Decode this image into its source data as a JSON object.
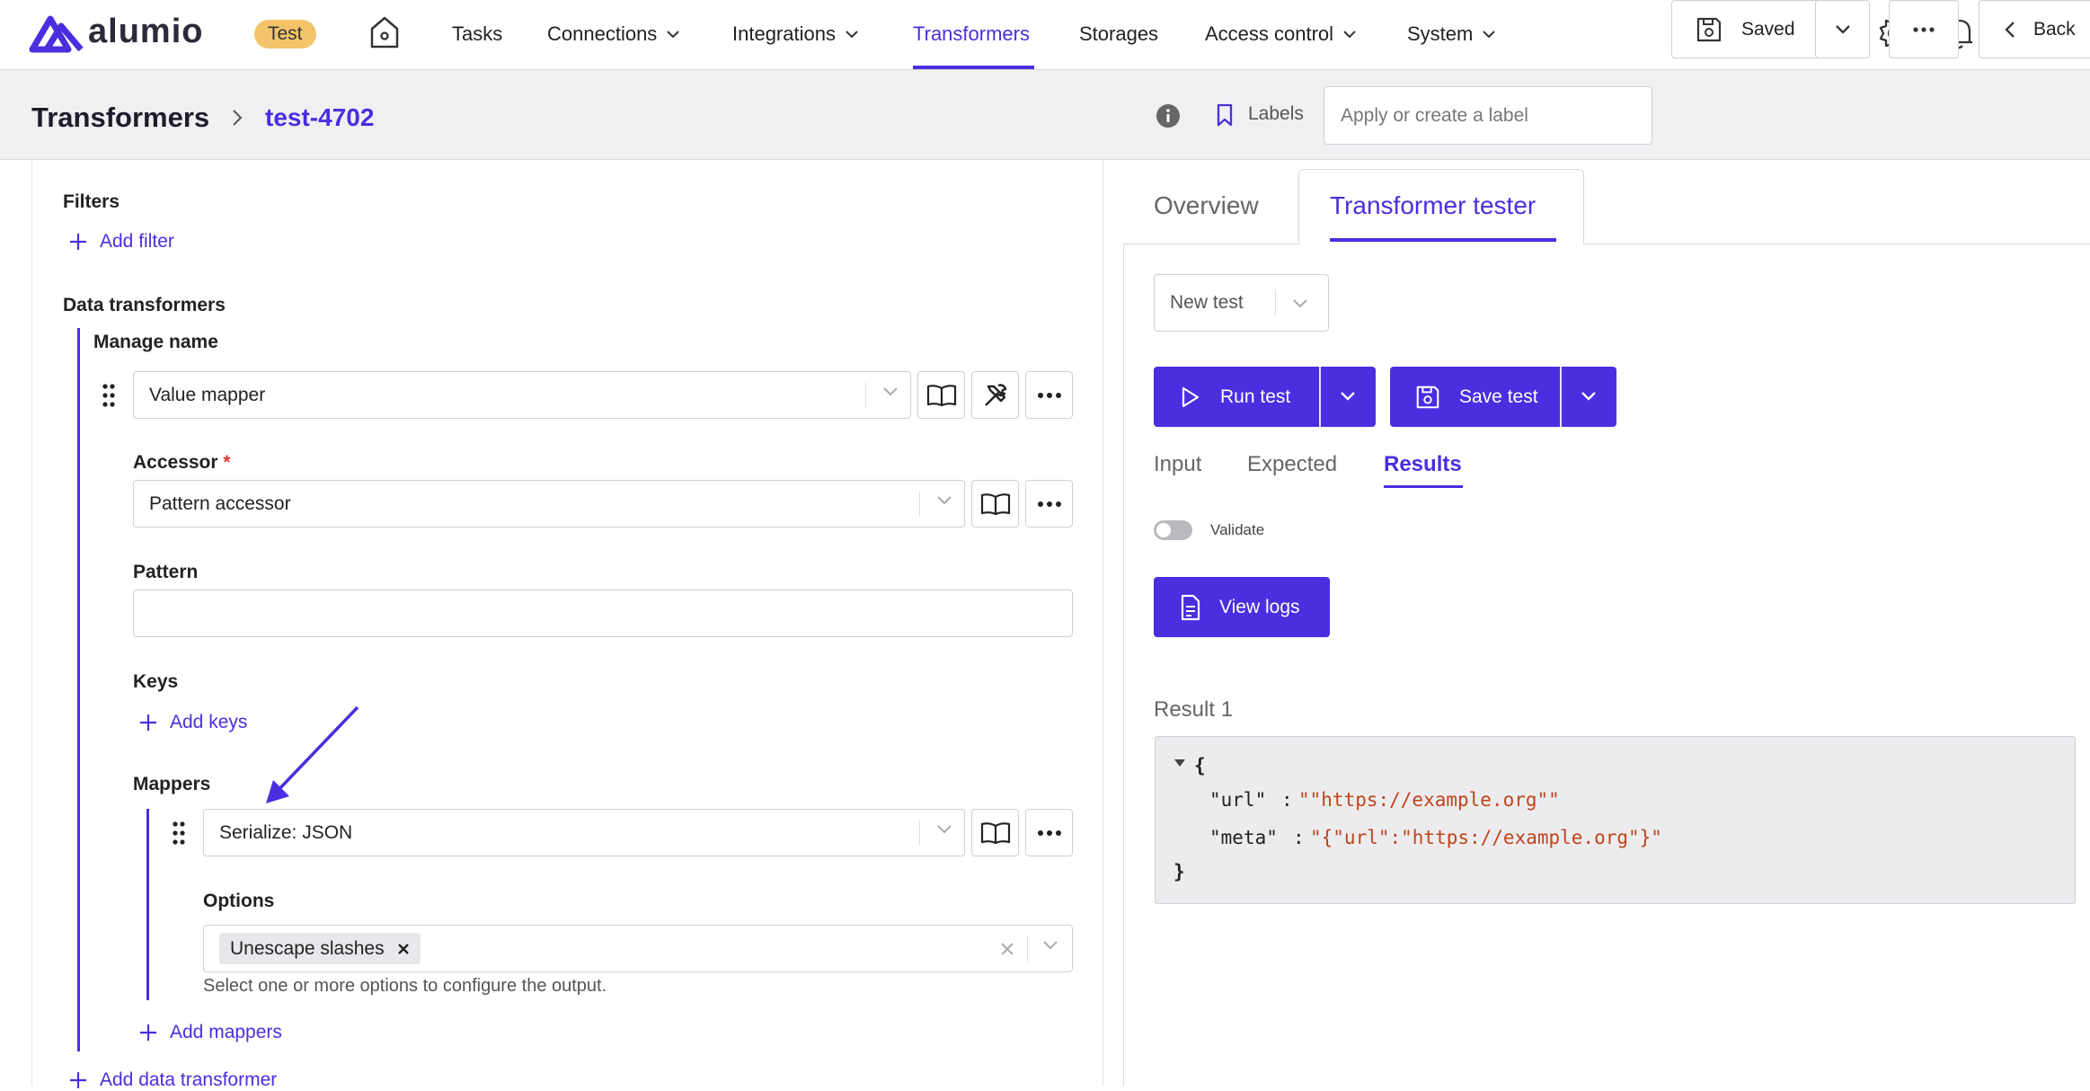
{
  "app": {
    "logo_text": "alumio",
    "env_badge": "Test"
  },
  "nav": {
    "items": [
      {
        "label": "Tasks"
      },
      {
        "label": "Connections"
      },
      {
        "label": "Integrations"
      },
      {
        "label": "Transformers"
      },
      {
        "label": "Storages"
      },
      {
        "label": "Access control"
      },
      {
        "label": "System"
      }
    ],
    "active": "Transformers",
    "icons": [
      "home-icon",
      "settings-icon",
      "bell-icon",
      "help-icon",
      "user-icon"
    ]
  },
  "header": {
    "breadcrumb_root": "Transformers",
    "breadcrumb_current": "test-4702",
    "labels_label": "Labels",
    "label_placeholder": "Apply or create a label",
    "saved_label": "Saved",
    "back_label": "Back"
  },
  "left": {
    "filters_label": "Filters",
    "add_filter": "Add filter",
    "data_transformers_label": "Data transformers",
    "manage_name_label": "Manage name",
    "transformer_select": "Value mapper",
    "accessor_label": "Accessor",
    "required_mark": "*",
    "accessor_select": "Pattern accessor",
    "pattern_label": "Pattern",
    "pattern_value": "",
    "keys_label": "Keys",
    "add_keys": "Add keys",
    "mappers_label": "Mappers",
    "mapper_select": "Serialize: JSON",
    "options_label": "Options",
    "option_chip": "Unescape slashes",
    "options_helper": "Select one or more options to configure the output.",
    "add_mappers": "Add mappers",
    "add_data_transformer": "Add data transformer"
  },
  "right": {
    "tabs": [
      {
        "label": "Overview"
      },
      {
        "label": "Transformer tester"
      }
    ],
    "active_tab": "Transformer tester",
    "test_select": "New test",
    "run_test": "Run test",
    "save_test": "Save test",
    "subtabs": [
      {
        "label": "Input"
      },
      {
        "label": "Expected"
      },
      {
        "label": "Results"
      }
    ],
    "active_subtab": "Results",
    "validate_label": "Validate",
    "validate_on": false,
    "view_logs": "View logs",
    "result_title": "Result 1",
    "result": {
      "open_brace": "{",
      "close_brace": "}",
      "url_key": "\"url\"",
      "url_value": "\"\"https://example.org\"\"",
      "meta_key": "\"meta\"",
      "meta_value": "\"{\"url\":\"https://example.org\"}\"",
      "colon": ":"
    }
  },
  "colors": {
    "accent": "#4a2ee0",
    "badge": "#f3c46a",
    "string_value": "#c0441a"
  }
}
